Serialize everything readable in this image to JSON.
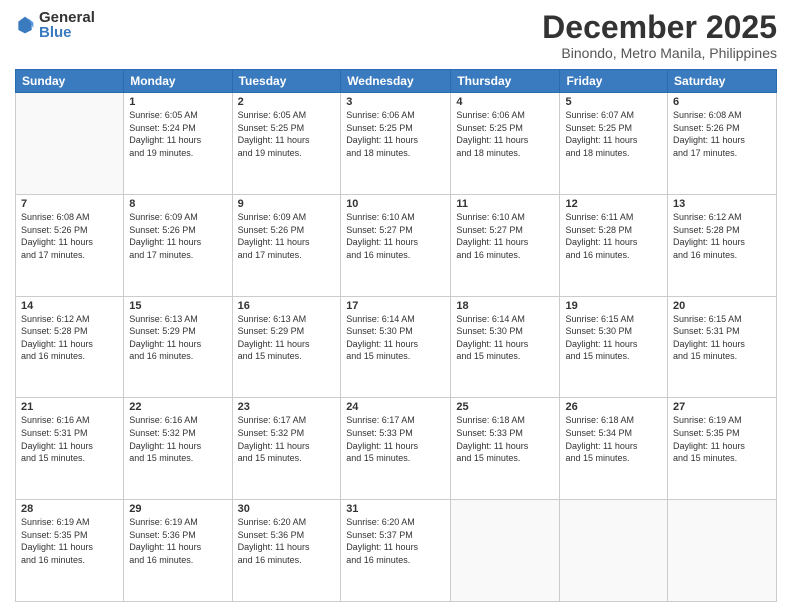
{
  "header": {
    "logo_general": "General",
    "logo_blue": "Blue",
    "title": "December 2025",
    "subtitle": "Binondo, Metro Manila, Philippines"
  },
  "calendar": {
    "weekdays": [
      "Sunday",
      "Monday",
      "Tuesday",
      "Wednesday",
      "Thursday",
      "Friday",
      "Saturday"
    ],
    "weeks": [
      [
        {
          "day": "",
          "content": ""
        },
        {
          "day": "1",
          "content": "Sunrise: 6:05 AM\nSunset: 5:24 PM\nDaylight: 11 hours\nand 19 minutes."
        },
        {
          "day": "2",
          "content": "Sunrise: 6:05 AM\nSunset: 5:25 PM\nDaylight: 11 hours\nand 19 minutes."
        },
        {
          "day": "3",
          "content": "Sunrise: 6:06 AM\nSunset: 5:25 PM\nDaylight: 11 hours\nand 18 minutes."
        },
        {
          "day": "4",
          "content": "Sunrise: 6:06 AM\nSunset: 5:25 PM\nDaylight: 11 hours\nand 18 minutes."
        },
        {
          "day": "5",
          "content": "Sunrise: 6:07 AM\nSunset: 5:25 PM\nDaylight: 11 hours\nand 18 minutes."
        },
        {
          "day": "6",
          "content": "Sunrise: 6:08 AM\nSunset: 5:26 PM\nDaylight: 11 hours\nand 17 minutes."
        }
      ],
      [
        {
          "day": "7",
          "content": "Sunrise: 6:08 AM\nSunset: 5:26 PM\nDaylight: 11 hours\nand 17 minutes."
        },
        {
          "day": "8",
          "content": "Sunrise: 6:09 AM\nSunset: 5:26 PM\nDaylight: 11 hours\nand 17 minutes."
        },
        {
          "day": "9",
          "content": "Sunrise: 6:09 AM\nSunset: 5:26 PM\nDaylight: 11 hours\nand 17 minutes."
        },
        {
          "day": "10",
          "content": "Sunrise: 6:10 AM\nSunset: 5:27 PM\nDaylight: 11 hours\nand 16 minutes."
        },
        {
          "day": "11",
          "content": "Sunrise: 6:10 AM\nSunset: 5:27 PM\nDaylight: 11 hours\nand 16 minutes."
        },
        {
          "day": "12",
          "content": "Sunrise: 6:11 AM\nSunset: 5:28 PM\nDaylight: 11 hours\nand 16 minutes."
        },
        {
          "day": "13",
          "content": "Sunrise: 6:12 AM\nSunset: 5:28 PM\nDaylight: 11 hours\nand 16 minutes."
        }
      ],
      [
        {
          "day": "14",
          "content": "Sunrise: 6:12 AM\nSunset: 5:28 PM\nDaylight: 11 hours\nand 16 minutes."
        },
        {
          "day": "15",
          "content": "Sunrise: 6:13 AM\nSunset: 5:29 PM\nDaylight: 11 hours\nand 16 minutes."
        },
        {
          "day": "16",
          "content": "Sunrise: 6:13 AM\nSunset: 5:29 PM\nDaylight: 11 hours\nand 15 minutes."
        },
        {
          "day": "17",
          "content": "Sunrise: 6:14 AM\nSunset: 5:30 PM\nDaylight: 11 hours\nand 15 minutes."
        },
        {
          "day": "18",
          "content": "Sunrise: 6:14 AM\nSunset: 5:30 PM\nDaylight: 11 hours\nand 15 minutes."
        },
        {
          "day": "19",
          "content": "Sunrise: 6:15 AM\nSunset: 5:30 PM\nDaylight: 11 hours\nand 15 minutes."
        },
        {
          "day": "20",
          "content": "Sunrise: 6:15 AM\nSunset: 5:31 PM\nDaylight: 11 hours\nand 15 minutes."
        }
      ],
      [
        {
          "day": "21",
          "content": "Sunrise: 6:16 AM\nSunset: 5:31 PM\nDaylight: 11 hours\nand 15 minutes."
        },
        {
          "day": "22",
          "content": "Sunrise: 6:16 AM\nSunset: 5:32 PM\nDaylight: 11 hours\nand 15 minutes."
        },
        {
          "day": "23",
          "content": "Sunrise: 6:17 AM\nSunset: 5:32 PM\nDaylight: 11 hours\nand 15 minutes."
        },
        {
          "day": "24",
          "content": "Sunrise: 6:17 AM\nSunset: 5:33 PM\nDaylight: 11 hours\nand 15 minutes."
        },
        {
          "day": "25",
          "content": "Sunrise: 6:18 AM\nSunset: 5:33 PM\nDaylight: 11 hours\nand 15 minutes."
        },
        {
          "day": "26",
          "content": "Sunrise: 6:18 AM\nSunset: 5:34 PM\nDaylight: 11 hours\nand 15 minutes."
        },
        {
          "day": "27",
          "content": "Sunrise: 6:19 AM\nSunset: 5:35 PM\nDaylight: 11 hours\nand 15 minutes."
        }
      ],
      [
        {
          "day": "28",
          "content": "Sunrise: 6:19 AM\nSunset: 5:35 PM\nDaylight: 11 hours\nand 16 minutes."
        },
        {
          "day": "29",
          "content": "Sunrise: 6:19 AM\nSunset: 5:36 PM\nDaylight: 11 hours\nand 16 minutes."
        },
        {
          "day": "30",
          "content": "Sunrise: 6:20 AM\nSunset: 5:36 PM\nDaylight: 11 hours\nand 16 minutes."
        },
        {
          "day": "31",
          "content": "Sunrise: 6:20 AM\nSunset: 5:37 PM\nDaylight: 11 hours\nand 16 minutes."
        },
        {
          "day": "",
          "content": ""
        },
        {
          "day": "",
          "content": ""
        },
        {
          "day": "",
          "content": ""
        }
      ]
    ]
  }
}
